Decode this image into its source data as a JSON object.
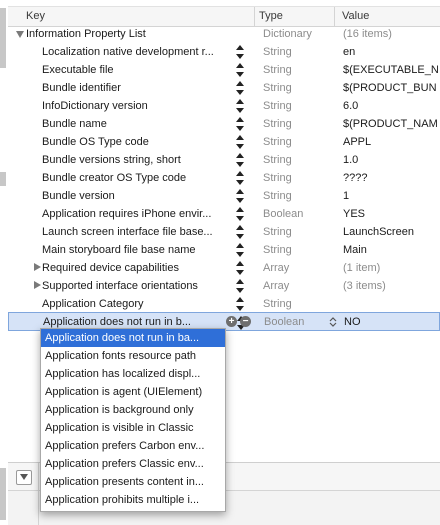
{
  "header": {
    "key": "Key",
    "type": "Type",
    "value": "Value"
  },
  "root": {
    "key": "Information Property List",
    "type": "Dictionary",
    "value": "(16 items)"
  },
  "rows": [
    {
      "key": "Localization native development r...",
      "type": "String",
      "value": "en"
    },
    {
      "key": "Executable file",
      "type": "String",
      "value": "$(EXECUTABLE_N"
    },
    {
      "key": "Bundle identifier",
      "type": "String",
      "value": "$(PRODUCT_BUN"
    },
    {
      "key": "InfoDictionary version",
      "type": "String",
      "value": "6.0"
    },
    {
      "key": "Bundle name",
      "type": "String",
      "value": "$(PRODUCT_NAM"
    },
    {
      "key": "Bundle OS Type code",
      "type": "String",
      "value": "APPL"
    },
    {
      "key": "Bundle versions string, short",
      "type": "String",
      "value": "1.0"
    },
    {
      "key": "Bundle creator OS Type code",
      "type": "String",
      "value": "????"
    },
    {
      "key": "Bundle version",
      "type": "String",
      "value": "1"
    },
    {
      "key": "Application requires iPhone envir...",
      "type": "Boolean",
      "value": "YES"
    },
    {
      "key": "Launch screen interface file base...",
      "type": "String",
      "value": "LaunchScreen"
    },
    {
      "key": "Main storyboard file base name",
      "type": "String",
      "value": "Main"
    },
    {
      "key": "Required device capabilities",
      "type": "Array",
      "value": "(1 item)"
    },
    {
      "key": "Supported interface orientations",
      "type": "Array",
      "value": "(3 items)"
    },
    {
      "key": "Application Category",
      "type": "String",
      "value": ""
    }
  ],
  "selected_row": {
    "key": "Application does not run in b...",
    "type": "Boolean",
    "value": "NO"
  },
  "dropdown_items": [
    "Application does not run in ba...",
    "Application fonts resource path",
    "Application has localized displ...",
    "Application is agent (UIElement)",
    "Application is background only",
    "Application is visible in Classic",
    "Application prefers Carbon env...",
    "Application prefers Classic env...",
    "Application presents content in...",
    "Application prohibits multiple i..."
  ],
  "icons": {
    "stepper": "updown-arrows-icon",
    "add": "add-circle-icon",
    "remove": "remove-circle-icon"
  },
  "colors": {
    "selection": "#2f6fd8",
    "selected_row_bg": "#d6e3f7"
  }
}
